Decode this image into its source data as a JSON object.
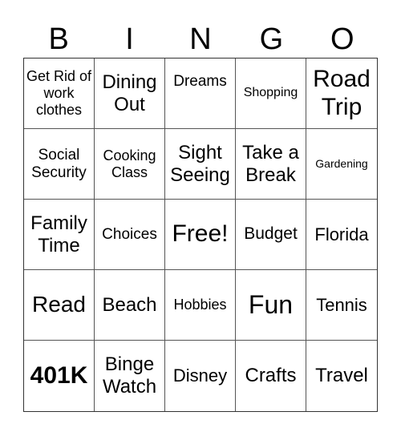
{
  "header": {
    "letters": [
      "B",
      "I",
      "N",
      "G",
      "O"
    ]
  },
  "cells": [
    [
      "Get Rid of work clothes",
      "Dining Out",
      "Dreams",
      "Shopping",
      "Road Trip"
    ],
    [
      "Social Security",
      "Cooking Class",
      "Sight Seeing",
      "Take a Break",
      "Gardening"
    ],
    [
      "Family Time",
      "Choices",
      "Free!",
      "Budget",
      "Florida"
    ],
    [
      "Read",
      "Beach",
      "Hobbies",
      "Fun",
      "Tennis"
    ],
    [
      "401K",
      "Binge Watch",
      "Disney",
      "Crafts",
      "Travel"
    ]
  ]
}
